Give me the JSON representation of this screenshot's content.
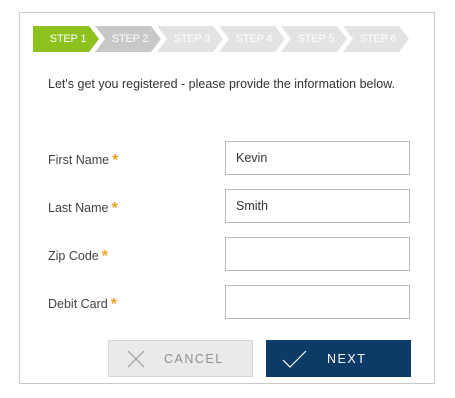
{
  "stepper": {
    "steps": [
      {
        "label": "STEP 1",
        "state": "active"
      },
      {
        "label": "STEP 2",
        "state": "next"
      },
      {
        "label": "STEP 3",
        "state": "inactive"
      },
      {
        "label": "STEP 4",
        "state": "inactive"
      },
      {
        "label": "STEP 5",
        "state": "inactive"
      },
      {
        "label": "STEP 6",
        "state": "inactive"
      }
    ],
    "colors": {
      "active": "#8dc11e",
      "next": "#c8c8c8",
      "inactive": "#e3e3e3"
    }
  },
  "intro": "Let's get you registered - please provide the information below.",
  "form": {
    "required_mark": "*",
    "fields": [
      {
        "label": "First Name",
        "value": "Kevin",
        "placeholder": ""
      },
      {
        "label": "Last Name",
        "value": "Smith",
        "placeholder": ""
      },
      {
        "label": "Zip Code",
        "value": "",
        "placeholder": ""
      },
      {
        "label": "Debit Card",
        "value": "",
        "placeholder": ""
      }
    ]
  },
  "buttons": {
    "cancel": {
      "label": "CANCEL",
      "icon": "close-icon"
    },
    "next": {
      "label": "NEXT",
      "icon": "checkmark-icon"
    }
  }
}
